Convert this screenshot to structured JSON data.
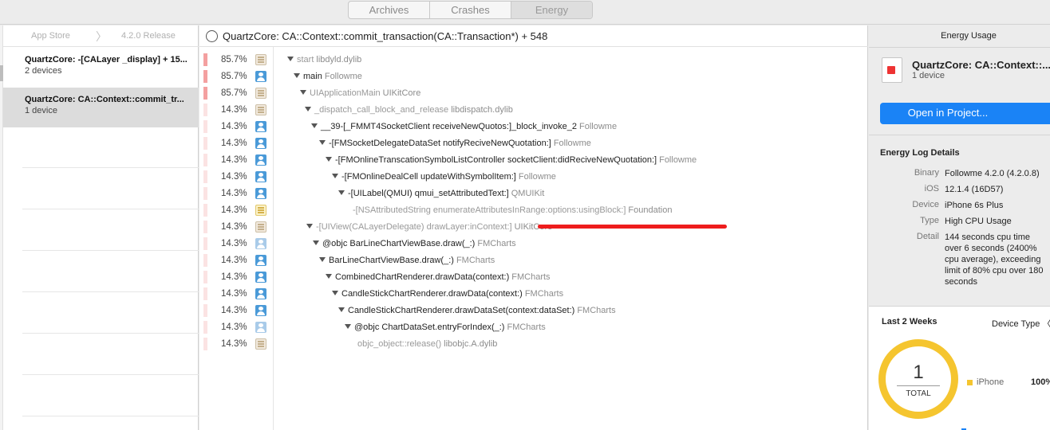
{
  "tabs": [
    {
      "label": "Archives",
      "active": false
    },
    {
      "label": "Crashes",
      "active": false
    },
    {
      "label": "Energy",
      "active": true
    }
  ],
  "breadcrumb": {
    "store": "App Store",
    "separator": "〉",
    "version": "4.2.0 Release"
  },
  "issues": [
    {
      "title": "QuartzCore: -[CALayer _display] + 15...",
      "devices": "2 devices",
      "selected": false
    },
    {
      "title": "QuartzCore: CA::Context::commit_tr...",
      "devices": "1 device",
      "selected": true
    }
  ],
  "call_tree": {
    "header": "QuartzCore: CA::Context::commit_transaction(CA::Transaction*) + 548",
    "rows": [
      {
        "pct": "85.7%",
        "hot": true,
        "icon": "system-library-icon",
        "sym": "start",
        "lib": "libdyld.dylib",
        "expanded": true,
        "dim": true
      },
      {
        "pct": "85.7%",
        "hot": true,
        "icon": "user-code-icon",
        "sym": "main",
        "lib": "Followme",
        "expanded": true,
        "dim": false
      },
      {
        "pct": "85.7%",
        "hot": true,
        "icon": "system-library-icon",
        "sym": "UIApplicationMain",
        "lib": "UIKitCore",
        "expanded": true,
        "dim": true
      },
      {
        "pct": "14.3%",
        "hot": false,
        "icon": "system-library-icon",
        "sym": "_dispatch_call_block_and_release",
        "lib": "libdispatch.dylib",
        "expanded": true,
        "dim": true
      },
      {
        "pct": "14.3%",
        "hot": false,
        "icon": "user-code-icon",
        "sym": "__39-[_FMMT4SocketClient receiveNewQuotos:]_block_invoke_2",
        "lib": "Followme",
        "expanded": true,
        "dim": false
      },
      {
        "pct": "14.3%",
        "hot": false,
        "icon": "user-code-icon",
        "sym": "-[FMSocketDelegateDataSet notifyReciveNewQuotation:]",
        "lib": "Followme",
        "expanded": true,
        "dim": false
      },
      {
        "pct": "14.3%",
        "hot": false,
        "icon": "user-code-icon",
        "sym": "-[FMOnlineTranscationSymbolListController socketClient:didReciveNewQuotation:]",
        "lib": "Followme",
        "expanded": true,
        "dim": false
      },
      {
        "pct": "14.3%",
        "hot": false,
        "icon": "user-code-icon",
        "sym": "-[FMOnlineDealCell updateWithSymbolItem:]",
        "lib": "Followme",
        "expanded": true,
        "dim": false
      },
      {
        "pct": "14.3%",
        "hot": false,
        "icon": "user-code-icon",
        "sym": "-[UILabel(QMUI) qmui_setAttributedText:]",
        "lib": "QMUIKit",
        "expanded": true,
        "dim": false
      },
      {
        "pct": "14.3%",
        "hot": false,
        "icon": "foundation-icon",
        "sym": "-[NSAttributedString enumerateAttributesInRange:options:usingBlock:]",
        "lib": "Foundation",
        "expanded": false,
        "dim": true
      },
      {
        "pct": "14.3%",
        "hot": false,
        "icon": "system-library-icon",
        "sym": "-[UIView(CALayerDelegate) drawLayer:inContext:]",
        "lib": "UIKitCore",
        "expanded": true,
        "dim": true
      },
      {
        "pct": "14.3%",
        "hot": false,
        "icon": "user-code-light-icon",
        "sym": "@objc BarLineChartViewBase.draw(_:)",
        "lib": "FMCharts",
        "expanded": true,
        "dim": false
      },
      {
        "pct": "14.3%",
        "hot": false,
        "icon": "user-code-icon",
        "sym": "BarLineChartViewBase.draw(_:)",
        "lib": "FMCharts",
        "expanded": true,
        "dim": false
      },
      {
        "pct": "14.3%",
        "hot": false,
        "icon": "user-code-icon",
        "sym": "CombinedChartRenderer.drawData(context:)",
        "lib": "FMCharts",
        "expanded": true,
        "dim": false
      },
      {
        "pct": "14.3%",
        "hot": false,
        "icon": "user-code-icon",
        "sym": "CandleStickChartRenderer.drawData(context:)",
        "lib": "FMCharts",
        "expanded": true,
        "dim": false
      },
      {
        "pct": "14.3%",
        "hot": false,
        "icon": "user-code-icon",
        "sym": "CandleStickChartRenderer.drawDataSet(context:dataSet:)",
        "lib": "FMCharts",
        "expanded": true,
        "dim": false
      },
      {
        "pct": "14.3%",
        "hot": false,
        "icon": "user-code-light-icon",
        "sym": "@objc ChartDataSet.entryForIndex(_:)",
        "lib": "FMCharts",
        "expanded": true,
        "dim": false
      },
      {
        "pct": "14.3%",
        "hot": false,
        "icon": "system-library-icon",
        "sym": "objc_object::release()",
        "lib": "libobjc.A.dylib",
        "expanded": false,
        "dim": true
      }
    ]
  },
  "inspector": {
    "title": "Energy Usage",
    "app_title": "QuartzCore: CA::Context::...",
    "app_sub": "1 device",
    "open_button": "Open in Project...",
    "log_heading": "Energy Log Details",
    "details": [
      {
        "key": "Binary",
        "value": "Followme 4.2.0 (4.2.0.8)"
      },
      {
        "key": "iOS",
        "value": "12.1.4 (16D57)"
      },
      {
        "key": "Device",
        "value": "iPhone 6s Plus"
      },
      {
        "key": "Type",
        "value": "High CPU Usage"
      },
      {
        "key": "Detail",
        "value": "144 seconds cpu time over 6 seconds (2400% cpu average), exceeding limit of 80% cpu over 180 seconds"
      }
    ],
    "weeks_title": "Last 2 Weeks",
    "device_type": "Device Type 〈",
    "total_value": "1",
    "total_label": "TOTAL",
    "legend_label": "iPhone",
    "legend_pct": "100%",
    "accent_color": "#f5c52f"
  }
}
